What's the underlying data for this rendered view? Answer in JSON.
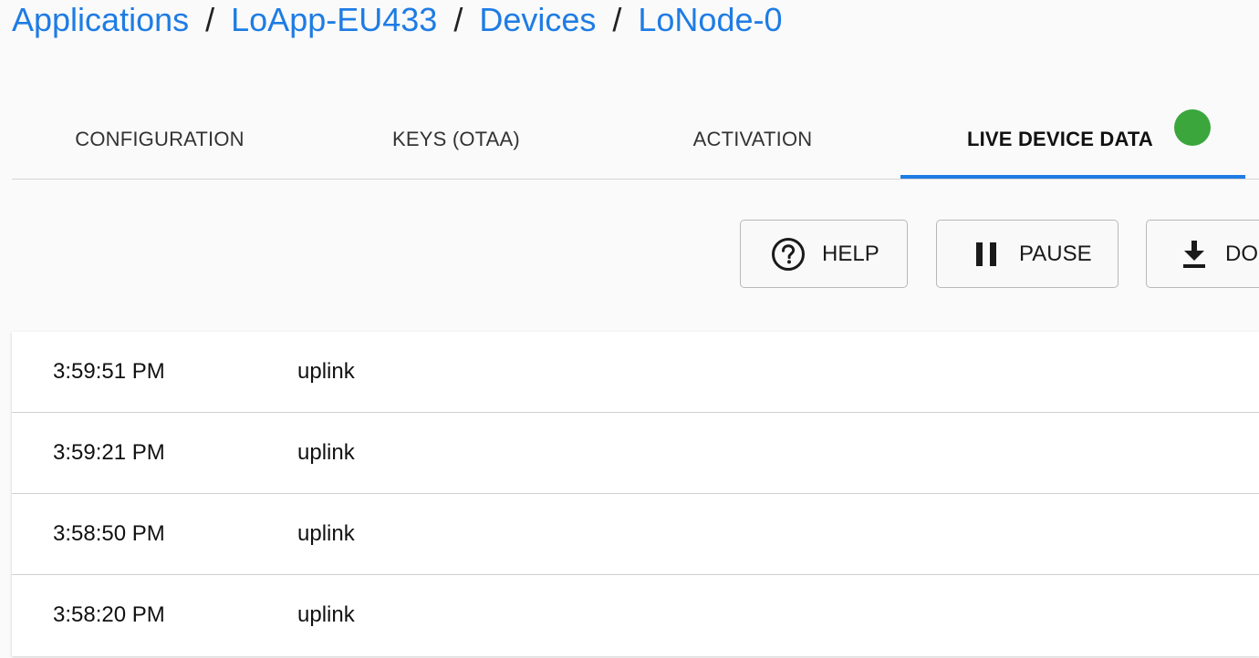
{
  "breadcrumb": {
    "applications": "Applications",
    "app": "LoApp-EU433",
    "devices": "Devices",
    "device": "LoNode-0",
    "separator": "/"
  },
  "tabs": {
    "configuration": "CONFIGURATION",
    "keys": "KEYS (OTAA)",
    "activation": "ACTIVATION",
    "live_data": "LIVE DEVICE DATA",
    "live_status_color": "#3aa63c",
    "active_tab": "LIVE DEVICE DATA"
  },
  "toolbar": {
    "help_label": "HELP",
    "pause_label": "PAUSE",
    "download_label": "DO"
  },
  "log": {
    "rows": [
      {
        "time": "3:59:51 PM",
        "type": "uplink"
      },
      {
        "time": "3:59:21 PM",
        "type": "uplink"
      },
      {
        "time": "3:58:50 PM",
        "type": "uplink"
      },
      {
        "time": "3:58:20 PM",
        "type": "uplink"
      }
    ]
  },
  "colors": {
    "accent": "#1e7ce4",
    "status_online": "#3aa63c"
  }
}
